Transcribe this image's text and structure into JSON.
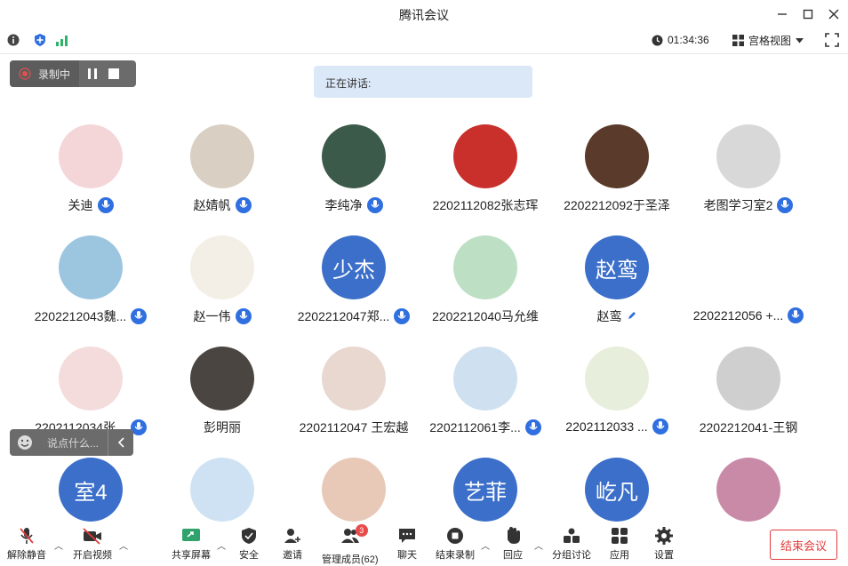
{
  "window": {
    "title": "腾讯会议"
  },
  "infobar": {
    "timer": "01:34:36",
    "view_mode": "宫格视图"
  },
  "recording": {
    "label": "录制中"
  },
  "speaking": {
    "label": "正在讲话:"
  },
  "participants": [
    {
      "name": "关迪",
      "avatar_text": "",
      "color": "#f4d6d9",
      "icon": "mic"
    },
    {
      "name": "赵婧帆",
      "avatar_text": "",
      "color": "#d9cfc2",
      "icon": "mic"
    },
    {
      "name": "李纯净",
      "avatar_text": "",
      "color": "#3c5a4a",
      "icon": "mic"
    },
    {
      "name": "2202112082张志珲",
      "avatar_text": "",
      "color": "#c9302c",
      "icon": ""
    },
    {
      "name": "2202212092于圣泽",
      "avatar_text": "",
      "color": "#5a3a2a",
      "icon": ""
    },
    {
      "name": "老图学习室2",
      "avatar_text": "",
      "color": "#d8d8d8",
      "icon": "mic"
    },
    {
      "name": "2202212043魏...",
      "avatar_text": "",
      "color": "#9cc6e0",
      "icon": "mic"
    },
    {
      "name": "赵一伟",
      "avatar_text": "",
      "color": "#f3efe6",
      "icon": "mic"
    },
    {
      "name": "2202212047郑...",
      "avatar_text": "少杰",
      "color": "#3b6fc9",
      "icon": "mic"
    },
    {
      "name": "2202212040马允维",
      "avatar_text": "",
      "color": "#bde0c5",
      "icon": ""
    },
    {
      "name": "赵鸾",
      "avatar_text": "赵鸾",
      "color": "#3b6fc9",
      "icon": "pencil"
    },
    {
      "name": "2202212056 +...",
      "avatar_text": "",
      "color": "#ffffff",
      "icon": "mic"
    },
    {
      "name": "2202112034张...",
      "avatar_text": "",
      "color": "#f4dcdc",
      "icon": "mic"
    },
    {
      "name": "彭明丽",
      "avatar_text": "",
      "color": "#4a4540",
      "icon": ""
    },
    {
      "name": "2202112047 王宏越",
      "avatar_text": "",
      "color": "#e8d8d0",
      "icon": ""
    },
    {
      "name": "2202112061李...",
      "avatar_text": "",
      "color": "#cfe0f0",
      "icon": "mic"
    },
    {
      "name": "2202112033 ...",
      "avatar_text": "",
      "color": "#e8eedc",
      "icon": "mic"
    },
    {
      "name": "2202212041-王钢",
      "avatar_text": "",
      "color": "#cfcfcf",
      "icon": ""
    },
    {
      "name": "",
      "avatar_text": "室4",
      "color": "#3b6fc9",
      "icon": ""
    },
    {
      "name": "",
      "avatar_text": "",
      "color": "#cfe2f4",
      "icon": ""
    },
    {
      "name": "",
      "avatar_text": "",
      "color": "#e8c9b8",
      "icon": ""
    },
    {
      "name": "",
      "avatar_text": "艺菲",
      "color": "#3b6fc9",
      "icon": ""
    },
    {
      "name": "",
      "avatar_text": "屹凡",
      "color": "#3b6fc9",
      "icon": ""
    },
    {
      "name": "",
      "avatar_text": "",
      "color": "#c98aa8",
      "icon": ""
    }
  ],
  "chat": {
    "placeholder": "说点什么..."
  },
  "toolbar": {
    "unmute": "解除静音",
    "video": "开启视频",
    "share": "共享屏幕",
    "security": "安全",
    "invite": "邀请",
    "members": "管理成员(62)",
    "members_badge": "3",
    "chat": "聊天",
    "end_record": "结束录制",
    "reactions": "回应",
    "breakout": "分组讨论",
    "apps": "应用",
    "settings": "设置",
    "end_meeting": "结束会议"
  },
  "colors": {
    "accent": "#2f6fe0",
    "danger": "#e03b3b",
    "avatar_blue": "#3b6fc9"
  }
}
